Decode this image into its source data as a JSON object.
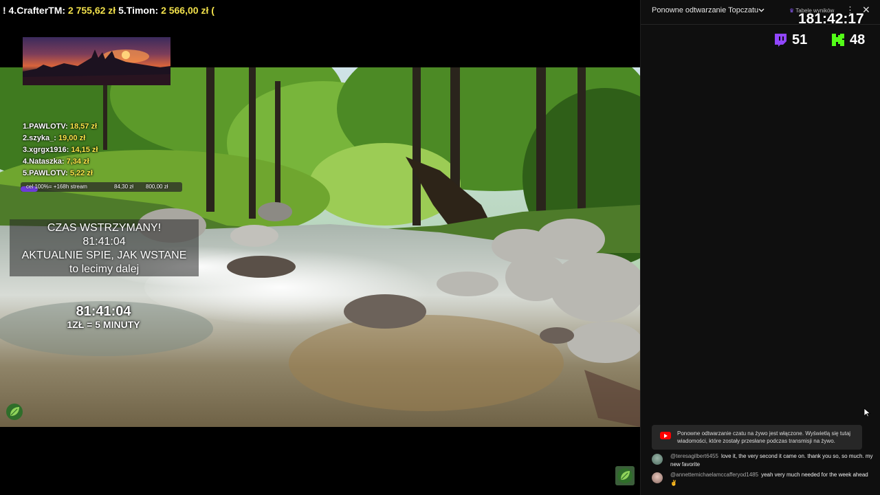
{
  "ticker": [
    {
      "prefix": "! 4.",
      "name": "CrafterTM:",
      "amount": "2 755,62 zł"
    },
    {
      "prefix": " 5.",
      "name": "Timon:",
      "amount": "2 566,00 zł ("
    }
  ],
  "leaderboard": [
    {
      "name": "1.PAWLOTV:",
      "amount": "18,57 zł"
    },
    {
      "name": "2.szyka_:",
      "amount": "19,00 zł"
    },
    {
      "name": "3.xgrgx1916:",
      "amount": "14,15 zł"
    },
    {
      "name": "4.Nataszka:",
      "amount": "7,34 zł"
    },
    {
      "name": "5.PAWLOTV:",
      "amount": "5,22 zł"
    }
  ],
  "goal": {
    "label": "cel 100%= +168h stream",
    "current": "84,30 zł",
    "target": "800,00 zł",
    "progress": 0.105
  },
  "paused": {
    "line1": "CZAS WSTRZYMANY!",
    "line2": "81:41:04",
    "line3": "AKTUALNIE SPIE, JAK WSTANE",
    "line4": "to lecimy dalej"
  },
  "timer": {
    "value": "81:41:04",
    "rate": "1ZŁ = 5 MINUTY"
  },
  "chat": {
    "title": "Ponowne odtwarzanie Topczatu",
    "scores_label": "Tabele wyników",
    "clock": "181:42:17",
    "twitch_viewers": "51",
    "kick_viewers": "48",
    "notice": "Ponowne odtwarzanie czatu na żywo jest włączone. Wyświetlą się tutaj wiadomości, które zostały przesłane podczas transmisji na żywo.",
    "messages": [
      {
        "author": "@teresagilbert6455",
        "text": "love it, the very second it came on. thank you so, so much. my new favorite"
      },
      {
        "author": "@annettemichaelamccafferyod1485",
        "text": "yeah very much needed for the week ahead ✌️"
      }
    ]
  },
  "colors": {
    "accent_amount": "#ffe94a",
    "twitch": "#9146ff",
    "kick": "#53fc18",
    "youtube_red": "#ff0000",
    "goal_fill": "#6d3bd8"
  },
  "icons": {
    "twitch": "twitch-icon",
    "kick": "kick-icon",
    "leaf": "leaf-badge-icon",
    "youtube": "youtube-icon",
    "more": "more-vert-icon",
    "close": "close-icon",
    "chevron": "chevron-down-icon",
    "crown": "crown-icon",
    "cursor": "mouse-cursor-icon"
  }
}
